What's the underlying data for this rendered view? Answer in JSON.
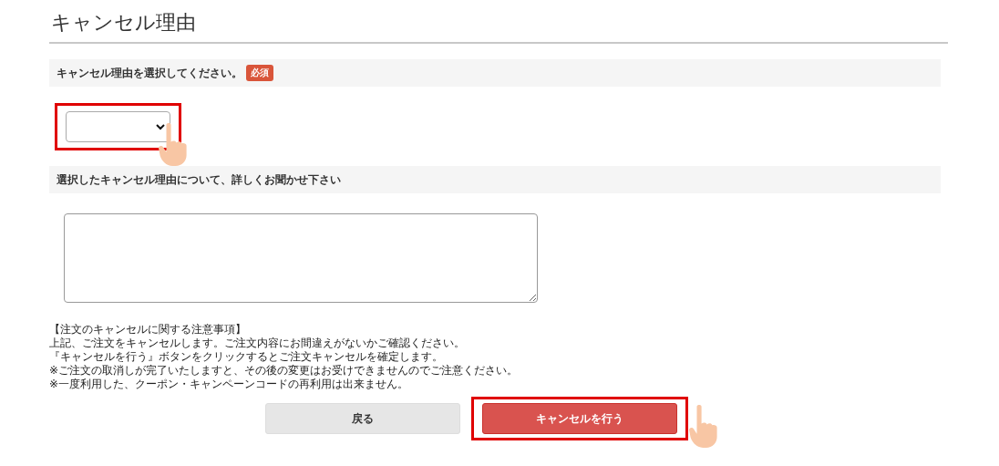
{
  "title": "キャンセル理由",
  "reason": {
    "label": "キャンセル理由を選択してください。",
    "badge": "必須",
    "highlighted": true
  },
  "detail": {
    "label": "選択したキャンセル理由について、詳しくお聞かせ下さい"
  },
  "notes": [
    "【注文のキャンセルに関する注意事項】",
    "上記、ご注文をキャンセルします。ご注文内容にお間違えがないかご確認ください。",
    "『キャンセルを行う』ボタンをクリックするとご注文キャンセルを確定します。",
    "※ご注文の取消しが完了いたしますと、その後の変更はお受けできませんのでご注意ください。",
    "※一度利用した、クーポン・キャンペーンコードの再利用は出来ません。"
  ],
  "buttons": [
    {
      "label": "戻る",
      "kind": "secondary",
      "highlighted": false
    },
    {
      "label": "キャンセルを行う",
      "kind": "primary",
      "highlighted": true
    }
  ]
}
